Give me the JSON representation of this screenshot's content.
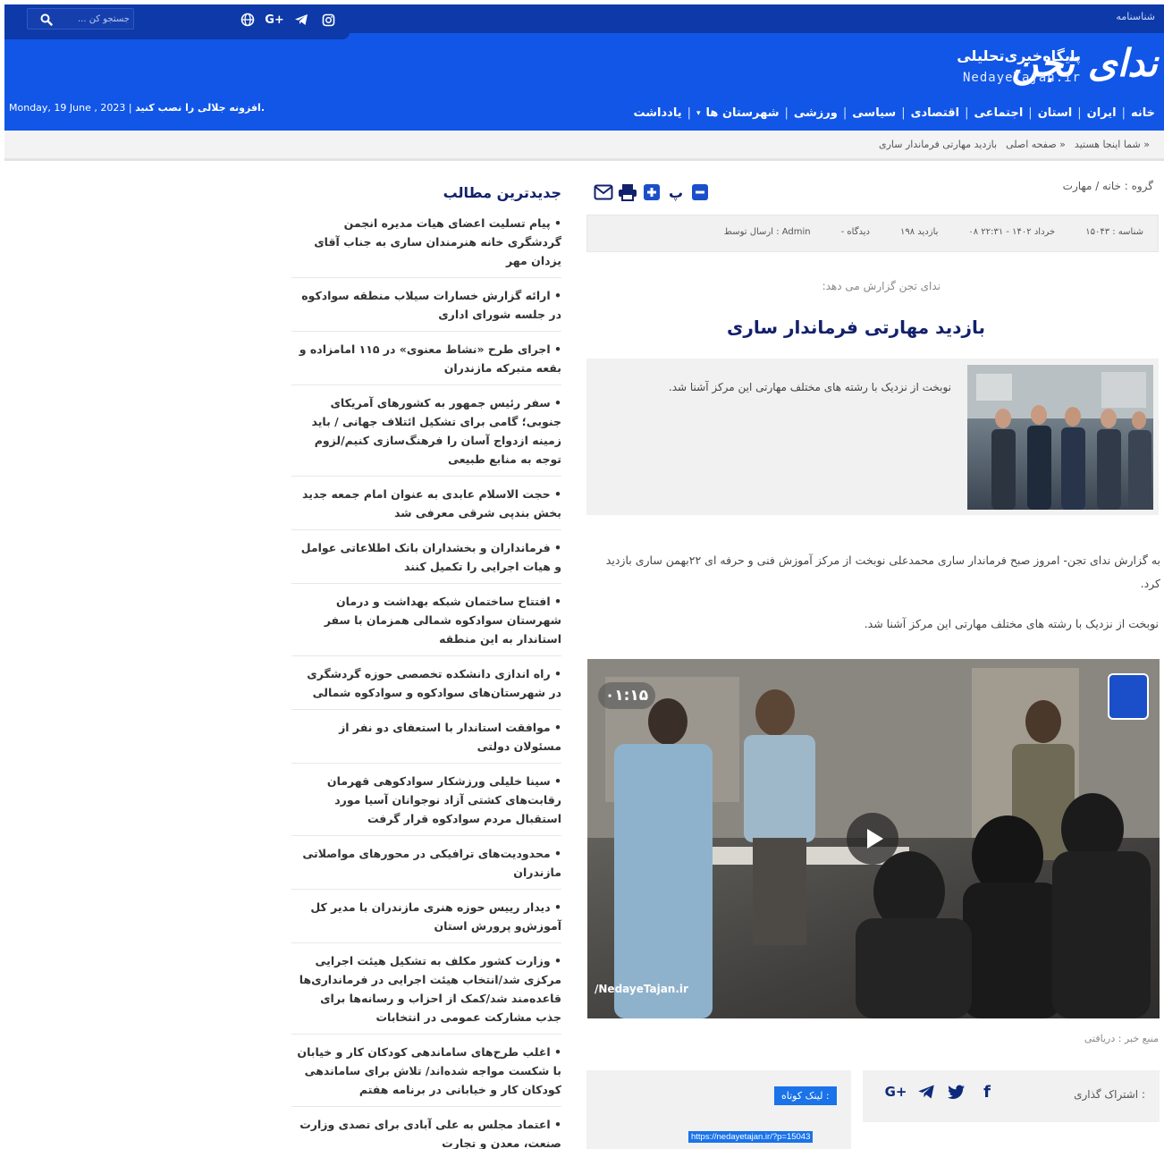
{
  "topbar": {
    "id_label": "شناسنامه",
    "search_placeholder": "جستجو کن ..."
  },
  "social_top_icons": [
    "globe-icon",
    "google-plus-icon",
    "telegram-icon",
    "instagram-icon"
  ],
  "header": {
    "logo_script": "ندای تجن",
    "logo_title": "پایگاه‌خبری‌تحلیلی",
    "logo_sub": "NedayeTajan.ir",
    "date_prefix": "افزونه جلالی را نصب کنید.",
    "date": "Monday, 19 June , 2023"
  },
  "nav": [
    "خانه",
    "ایران",
    "استان",
    "اجتماعی",
    "اقتصادی",
    "سیاسی",
    "ورزشی",
    "شهرستان ها",
    "یادداشت"
  ],
  "breadcrumb": {
    "prefix": "شما اینجا هستید »",
    "home": "صفحه اصلی »",
    "current": "بازدید مهارتی فرماندار ساری"
  },
  "article": {
    "group": "گروه : خانه / مهارت",
    "meta": {
      "id": "شناسه : ۱۵۰۴۳",
      "date": "۰۸ خرداد ۱۴۰۲ - ۲۲:۳۱",
      "views": "۱۹۸ بازدید",
      "comments": "- دیدگاه",
      "author": "ارسال توسط : Admin"
    },
    "lead": "ندای تجن گزارش می دهد:",
    "title": "بازدید مهارتی فرماندار ساری",
    "summary": "نوبخت از نزدیک با رشته های مختلف مهارتی این مرکز آشنا شد.",
    "body1": "به گزارش ندای تجن- امروز صبح فرماندار ساری محمدعلی نوبخت از مرکز آموزش فنی و حرفه ای ۲۲بهمن ساری بازدید کرد.",
    "body2": "نوبخت از نزدیک با رشته های مختلف مهارتی این مرکز آشنا شد.",
    "video_duration": "۰۱:۱۵",
    "video_watermark": "/NedayeTajan.ir",
    "source": "منبع خبر : دریافتی",
    "share_label": "اشتراک گذاری :",
    "short_label": "لینک کوتاه :",
    "short_url": "https://nedayetajan.ir/?p=15043"
  },
  "share_icons": [
    "google-plus-icon",
    "telegram-icon",
    "twitter-icon",
    "facebook-icon"
  ],
  "sidebar": {
    "title": "جدیدترین مطالب",
    "items": [
      "پیام تسلیت اعضای هیات مدیره انجمن گردشگری خانه هنرمندان ساری به جناب آقای یزدان مهر",
      "ارائه گزارش خسارات سیلاب منطقه سوادکوه در جلسه شورای اداری",
      "اجرای طرح «نشاط معنوی» در ۱۱۵ امامزاده و بقعه متبرکه مازندران",
      "سفر رئیس جمهور به کشورهای آمریکای جنوبی؛ گامی برای تشکیل ائتلاف جهانی / باید زمینه ازدواج آسان را فرهنگ‌سازی کنیم/لزوم توجه به منابع طبیعی",
      "حجت الاسلام عابدی به عنوان امام جمعه جدید بخش بندپی شرقی معرفی شد",
      "فرمانداران و بخشداران بانک اطلاعاتی عوامل و هیات اجرایی را تکمیل کنند",
      "افتتاح ساختمان شبکه بهداشت و درمان شهرستان سوادکوه شمالی همزمان با سفر استاندار به این منطقه",
      "راه اندازی دانشکده تخصصی حوزه گردشگری در شهرستان‌های سوادکوه و سوادکوه شمالی",
      "موافقت استاندار با استعفای دو نفر از مسئولان دولتی",
      "سینا خلیلی ورزشکار سوادکوهی قهرمان رقابت‌های کشتی آزاد نوجوانان آسیا مورد استقبال مردم سوادکوه قرار گرفت",
      "محدودیت‌های ترافیکی در محورهای مواصلاتی مازندران",
      "دیدار رییس حوزه هنری مازندران با مدیر کل آموزش‌و پرورش استان",
      "وزارت کشور مکلف به تشکیل هیئت اجرایی مرکزی شد/انتخاب هیئت اجرایی در فرمانداری‌ها قاعده‌مند شد/کمک از احزاب و رسانه‌ها برای جذب مشارکت عمومی در انتخابات",
      "اغلب طرح‌های ساماندهی کودکان کار و خیابان با شکست مواجه شده‌اند/ تلاش برای ساماندهی کودکان کار و خیابانی در برنامه هفتم",
      "اعتماد مجلس به علی آبادی برای تصدی وزارت صنعت، معدن و تجارت"
    ]
  },
  "colors": {
    "topbar": "#0d3aa8",
    "header": "#1156e6",
    "title_navy": "#12216b",
    "link_blue": "#1a73e8"
  }
}
